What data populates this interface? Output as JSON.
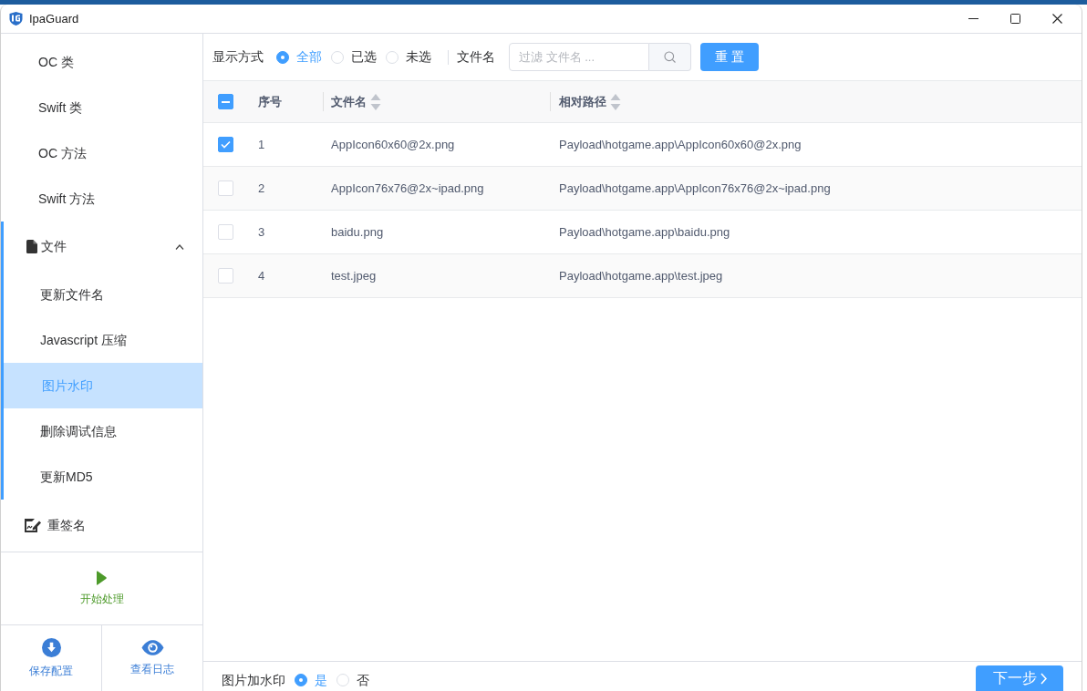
{
  "window": {
    "title": "IpaGuard"
  },
  "sidebar": {
    "items": [
      {
        "kind": "item",
        "label": "OC 类",
        "selected": false
      },
      {
        "kind": "item",
        "label": "Swift 类",
        "selected": false
      },
      {
        "kind": "item",
        "label": "OC 方法",
        "selected": false
      },
      {
        "kind": "item",
        "label": "Swift 方法",
        "selected": false
      },
      {
        "kind": "group",
        "label": "文件",
        "expanded": true,
        "children": [
          {
            "label": "更新文件名",
            "selected": false
          },
          {
            "label": "Javascript 压缩",
            "selected": false
          },
          {
            "label": "图片水印",
            "selected": true
          },
          {
            "label": "删除调试信息",
            "selected": false
          },
          {
            "label": "更新MD5",
            "selected": false
          }
        ]
      },
      {
        "kind": "link",
        "label": "重签名",
        "selected": false
      }
    ],
    "start_button": "开始处理",
    "actions": [
      {
        "kind": "download",
        "label": "保存配置"
      },
      {
        "kind": "view",
        "label": "查看日志"
      }
    ]
  },
  "toolbar": {
    "display_label": "显示方式",
    "display_options": [
      {
        "label": "全部",
        "selected": true
      },
      {
        "label": "已选",
        "selected": false
      },
      {
        "label": "未选",
        "selected": false
      }
    ],
    "filter_label": "文件名",
    "filter": {
      "placeholder": "过滤 文件名 ..."
    },
    "reset_button": "重置"
  },
  "table": {
    "select_all": {
      "indeterminate": true
    },
    "columns": [
      {
        "label": "序号",
        "sortable": false
      },
      {
        "label": "文件名",
        "sortable": true
      },
      {
        "label": "相对路径",
        "sortable": true
      }
    ],
    "rows": [
      {
        "checked": true,
        "index": "1",
        "name": "AppIcon60x60@2x.png",
        "path": "Payload\\hotgame.app\\AppIcon60x60@2x.png"
      },
      {
        "checked": false,
        "index": "2",
        "name": "AppIcon76x76@2x~ipad.png",
        "path": "Payload\\hotgame.app\\AppIcon76x76@2x~ipad.png"
      },
      {
        "checked": false,
        "index": "3",
        "name": "baidu.png",
        "path": "Payload\\hotgame.app\\baidu.png"
      },
      {
        "checked": false,
        "index": "4",
        "name": "test.jpeg",
        "path": "Payload\\hotgame.app\\test.jpeg"
      }
    ]
  },
  "footer": {
    "watermark_label": "图片加水印",
    "watermark_options": [
      {
        "label": "是",
        "selected": true
      },
      {
        "label": "否",
        "selected": false
      }
    ],
    "next_button": "下一步"
  }
}
